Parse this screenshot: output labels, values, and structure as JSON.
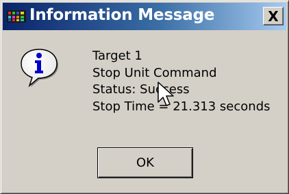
{
  "dialog": {
    "title": "Information Message",
    "close_label": "X",
    "icon": "information-icon",
    "messages": [
      "Target 1",
      "Stop Unit Command",
      "Status: Success",
      "Stop Time = 21.313 seconds"
    ],
    "ok_label": "OK"
  },
  "colors": {
    "titlebar_start": "#0a246a",
    "titlebar_end": "#a6caf0",
    "dialog_background": "#d4d0c8"
  },
  "overlay": {
    "cursor": "mouse-pointer-icon"
  }
}
